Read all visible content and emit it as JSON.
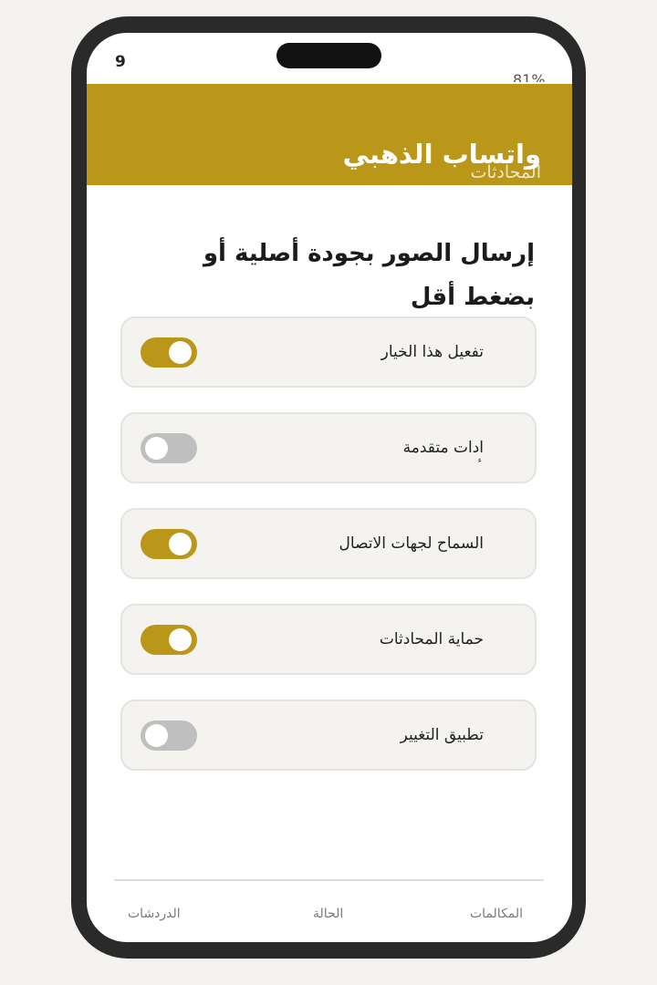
{
  "status_bar": {
    "left_text": "9",
    "right_text": "81%"
  },
  "header": {
    "title": "واتساب الذهبي",
    "subtitle": "المحادثات"
  },
  "section": {
    "title": "إرسال الصور بجودة أصلية أو بضغط أقل"
  },
  "settings": [
    {
      "label": "تفعيل هذا الخيار",
      "enabled": true
    },
    {
      "label": "ادات متقدمة",
      "enabled": false,
      "mark": "ء"
    },
    {
      "label": "السماح لجهات الاتصال",
      "enabled": true
    },
    {
      "label": "حماية المحادثات",
      "enabled": true
    },
    {
      "label": "تطبيق التغيير",
      "enabled": false
    }
  ],
  "bottom_nav": {
    "chats": "الدردشات",
    "status": "الحالة",
    "calls": "المكالمات"
  },
  "colors": {
    "accent": "#bb9719",
    "toggle_off": "#bfbfbf",
    "card_bg": "#f4f3f0"
  }
}
